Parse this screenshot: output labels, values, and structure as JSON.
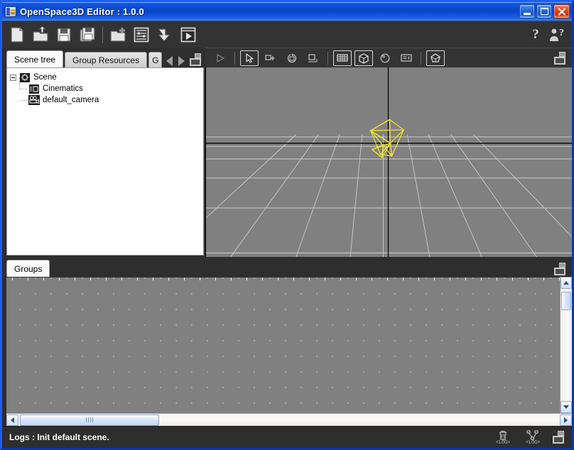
{
  "window": {
    "title": "OpenSpace3D Editor : 1.0.0",
    "app_icon": "app-icon",
    "controls": {
      "minimize": "minimize-button",
      "maximize": "maximize-button",
      "close": "close-button"
    }
  },
  "toolbar": {
    "buttons": [
      {
        "name": "new-scene",
        "icon": "new-document-icon"
      },
      {
        "name": "open-scene",
        "icon": "open-folder-icon"
      },
      {
        "name": "save-scene",
        "icon": "save-floppy-icon"
      },
      {
        "name": "save-scene-as",
        "icon": "save-as-floppy-icon"
      },
      {
        "name": "add-resource",
        "icon": "add-folder-icon"
      },
      {
        "name": "scene-settings",
        "icon": "settings-sliders-icon"
      },
      {
        "name": "import-object",
        "icon": "import-arrow-icon"
      },
      {
        "name": "run-scene",
        "icon": "play-window-icon"
      }
    ],
    "help": {
      "name": "help-button",
      "glyph": "?"
    },
    "about": {
      "name": "about-button",
      "glyph": "?"
    }
  },
  "left_dock": {
    "tabs": [
      {
        "label": "Scene tree",
        "active": true
      },
      {
        "label": "Group Resources",
        "active": false
      },
      {
        "label": "G",
        "active": false,
        "clipped": true
      }
    ],
    "nav": {
      "prev": "tab-scroll-left",
      "next": "tab-scroll-right"
    },
    "float": "float-panel-icon",
    "tree": {
      "root": {
        "label": "Scene",
        "icon": "scene-node-icon",
        "expanded": true
      },
      "children": [
        {
          "label": "Cinematics",
          "icon": "cinematics-node-icon"
        },
        {
          "label": "default_camera",
          "icon": "camera-node-icon"
        }
      ]
    }
  },
  "viewport": {
    "toolbar": [
      {
        "name": "vp-play",
        "icon": "play-icon",
        "active": false,
        "disabled": true
      },
      {
        "name": "vp-select",
        "icon": "cursor-arrow-icon",
        "active": true
      },
      {
        "name": "vp-move",
        "icon": "move-icon",
        "active": false
      },
      {
        "name": "vp-rotate",
        "icon": "rotate-icon",
        "active": false
      },
      {
        "name": "vp-scale",
        "icon": "scale-icon",
        "active": false
      },
      {
        "name": "vp-grid",
        "icon": "grid-icon",
        "active": false
      },
      {
        "name": "vp-solid-box",
        "icon": "box-icon",
        "active": true
      },
      {
        "name": "vp-light",
        "icon": "sphere-light-icon",
        "active": false
      },
      {
        "name": "vp-info",
        "icon": "info-panel-icon",
        "active": false
      },
      {
        "name": "vp-material",
        "icon": "gem-material-icon",
        "active": false
      }
    ],
    "float": "float-viewport-icon",
    "scene": {
      "background_color": "#808080",
      "grid_color": "#cfcfcf",
      "axis_color": "#000000",
      "gizmo_color": "#f2e42a",
      "gizmo_name": "default-camera-gizmo"
    }
  },
  "groups_dock": {
    "tabs": [
      {
        "label": "Groups",
        "active": true
      }
    ],
    "float": "float-groups-icon",
    "canvas": {
      "background_color": "#808080",
      "dot_color": "#ffffff"
    },
    "scrollbars": {
      "vertical": {
        "up": "scroll-up-arrow",
        "down": "scroll-down-arrow"
      },
      "horizontal": {
        "left": "scroll-left-arrow",
        "right": "scroll-right-arrow"
      }
    }
  },
  "statusbar": {
    "message": "Logs : Init default scene.",
    "buttons": [
      {
        "name": "clear-logs-button",
        "icon": "trash-icon",
        "label": "<LOG>"
      },
      {
        "name": "network-logs-button",
        "icon": "network-branch-icon",
        "label": "<LOG>"
      },
      {
        "name": "float-logs-button",
        "icon": "float-panel-icon",
        "label": ""
      }
    ]
  },
  "colors": {
    "title_blue": "#0a47cc",
    "panel_dark": "#2e2e2e",
    "toolbar_dark": "#333333",
    "viewport_gray": "#808080",
    "accent_yellow": "#f2e42a"
  }
}
